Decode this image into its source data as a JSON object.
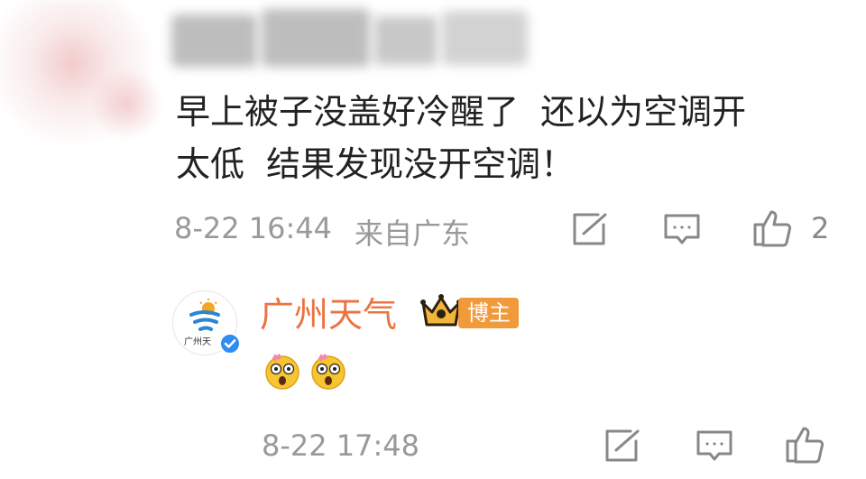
{
  "comment": {
    "text": "早上被子没盖好冷醒了  还以为空调开\n太低  结果发现没开空调！",
    "time": "8-22 16:44",
    "location": "来自广东",
    "actions": {
      "share_icon": "share-icon",
      "comment_icon": "comment-icon",
      "like_icon": "thumbs-up-icon",
      "like_count": "2"
    }
  },
  "reply": {
    "author": "广州天气",
    "avatar_label": "广州天",
    "verified_icon": "verified-icon",
    "crown_icon": "crown-icon",
    "badge": "博主",
    "emojis": [
      "shocked-face-emoji",
      "shocked-face-emoji"
    ],
    "time": "8-22 17:48",
    "actions": {
      "share_icon": "share-icon",
      "comment_icon": "comment-icon",
      "like_icon": "thumbs-up-icon"
    }
  },
  "colors": {
    "text": "#222222",
    "meta": "#999999",
    "icon": "#888888",
    "author": "#eb7340",
    "badge_bg": "#f09a3c",
    "verified": "#2f8cf0"
  }
}
